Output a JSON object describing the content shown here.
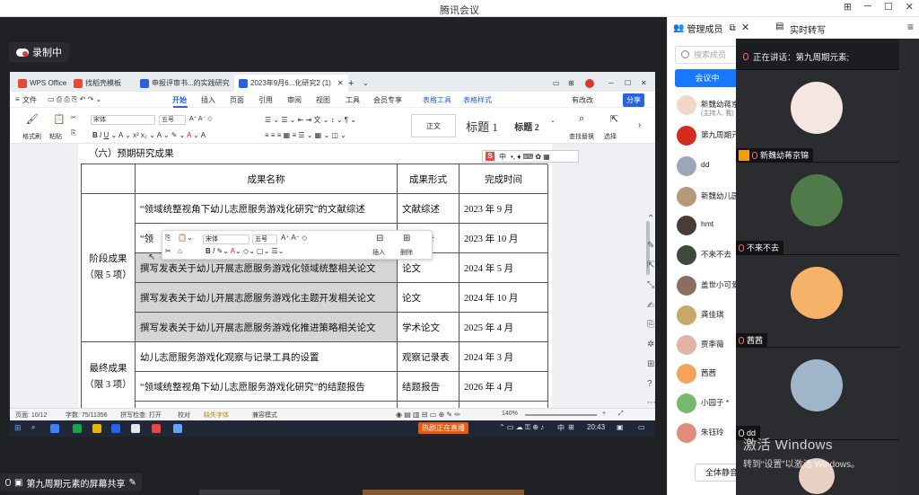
{
  "meeting": {
    "title": "腾讯会议",
    "recording": "录制中",
    "share_footer": "第九周期元素的屏幕共享"
  },
  "wps": {
    "tabs": [
      {
        "label": "WPS Office",
        "color": "#e8473b"
      },
      {
        "label": "找稻壳模板",
        "color": "#e8473b"
      },
      {
        "label": "申报评审书...的实践研究",
        "color": "#2b5fe0"
      },
      {
        "label": "2023年9月6...化研究2 (1)",
        "color": "#2b5fe0"
      }
    ],
    "menu": [
      "文件",
      "开始",
      "插入",
      "页面",
      "引用",
      "审阅",
      "视图",
      "工具",
      "会员专享",
      "表格工具",
      "表格样式"
    ],
    "active_menu": "开始",
    "menu_right": [
      "有改改",
      "分享"
    ],
    "ribbon": {
      "format_painter": "格式刷",
      "paste": "粘贴",
      "font": "宋体",
      "size": "五号",
      "style_normal": "正文",
      "style_h1": "标题 1",
      "style_h2": "标题 2",
      "find_replace": "查找替换",
      "select": "选择"
    },
    "ime": "中",
    "status": {
      "page": "页面: 10/12",
      "words": "字数: 75/11356",
      "spell": "拼写检查: 打开",
      "proofread": "校对",
      "missing_font": "缺失字体",
      "protect": "兼容模式",
      "zoom": "140%"
    }
  },
  "document": {
    "heading": "（六）预期研究成果",
    "columns": [
      "成果名称",
      "成果形式",
      "完成时间"
    ],
    "group1": "阶段成果\n（限 5 项）",
    "group2": "最终成果\n（限 3 项）",
    "rows": [
      {
        "name": "“领域统整视角下幼儿志愿服务游戏化研究”的文献综述",
        "form": "文献综述",
        "time": "2023 年 9 月",
        "hl": false
      },
      {
        "name": "“领",
        "form": "报告",
        "time": "2023 年 10 月",
        "hl": false
      },
      {
        "name": "撰写发表关于幼儿开展志愿服务游戏化领域统整相关论文",
        "form": "论文",
        "time": "2024 年 5 月",
        "hl": true
      },
      {
        "name": "撰写发表关于幼儿开展志愿服务游戏化主题开发相关论文",
        "form": "论文",
        "time": "2024 年 10 月",
        "hl": true
      },
      {
        "name": "撰写发表关于幼儿开展志愿服务游戏化推进策略相关论文",
        "form": "学术论文",
        "time": "2025 年 4 月",
        "hl": true
      },
      {
        "name": "幼儿志愿服务游戏化观察与记录工具的设置",
        "form": "观察记录表",
        "time": "2024 年 3 月",
        "hl": false
      },
      {
        "name": "“领域统整视角下幼儿志愿服务游戏化研究”的结题报告",
        "form": "结题报告",
        "time": "2026 年 4 月",
        "hl": false
      }
    ]
  },
  "float_toolbar": {
    "font": "宋体",
    "size": "五号",
    "insert": "插入",
    "delete": "删除"
  },
  "taskbar": {
    "time": "20:43",
    "ime": "中",
    "app_label": "热剧正在直播"
  },
  "members_panel": {
    "title": "管理成员",
    "search_placeholder": "搜索成员",
    "meeting_button": "会议中",
    "mute_all": "全体静音",
    "members": [
      {
        "name": "新魏幼蒋京",
        "sub": "(主持人, 我)",
        "color": "#f2d7c8"
      },
      {
        "name": "第九周期元",
        "sub": "",
        "color": "#d62a1e"
      },
      {
        "name": "dd",
        "sub": "",
        "color": "#9aa7b5"
      },
      {
        "name": "新魏幼儿园",
        "sub": "",
        "color": "#b59a7a"
      },
      {
        "name": "hmt",
        "sub": "",
        "color": "#4b3a35"
      },
      {
        "name": "不来不去",
        "sub": "",
        "color": "#3b4a3a"
      },
      {
        "name": "盖世小可爱",
        "sub": "",
        "color": "#8a6f60"
      },
      {
        "name": "龚佳琪",
        "sub": "",
        "color": "#c6a86a"
      },
      {
        "name": "贾季薇",
        "sub": "",
        "color": "#e0b5a6"
      },
      {
        "name": "茜茜",
        "sub": "",
        "color": "#f3a35a"
      },
      {
        "name": "小园子 *",
        "sub": "",
        "color": "#77b96a"
      },
      {
        "name": "朱钰玲",
        "sub": "",
        "color": "#e38c7e"
      }
    ]
  },
  "transcript": {
    "title": "实时转写",
    "speaking": "正在讲话：第九周期元素;"
  },
  "videos": [
    {
      "name": "新魏幼蒋京锦",
      "color": "#f5e6e1",
      "mic": "orange"
    },
    {
      "name": "不来不去",
      "color": "#4f7a49",
      "mic": "red"
    },
    {
      "name": "茜茜",
      "color": "#f7b26a",
      "mic": "red"
    },
    {
      "name": "dd",
      "color": "#9fb5c9",
      "mic": "white"
    }
  ],
  "watermark": {
    "line1": "激活 Windows",
    "line2": "转到“设置”以激活 Windows。"
  }
}
